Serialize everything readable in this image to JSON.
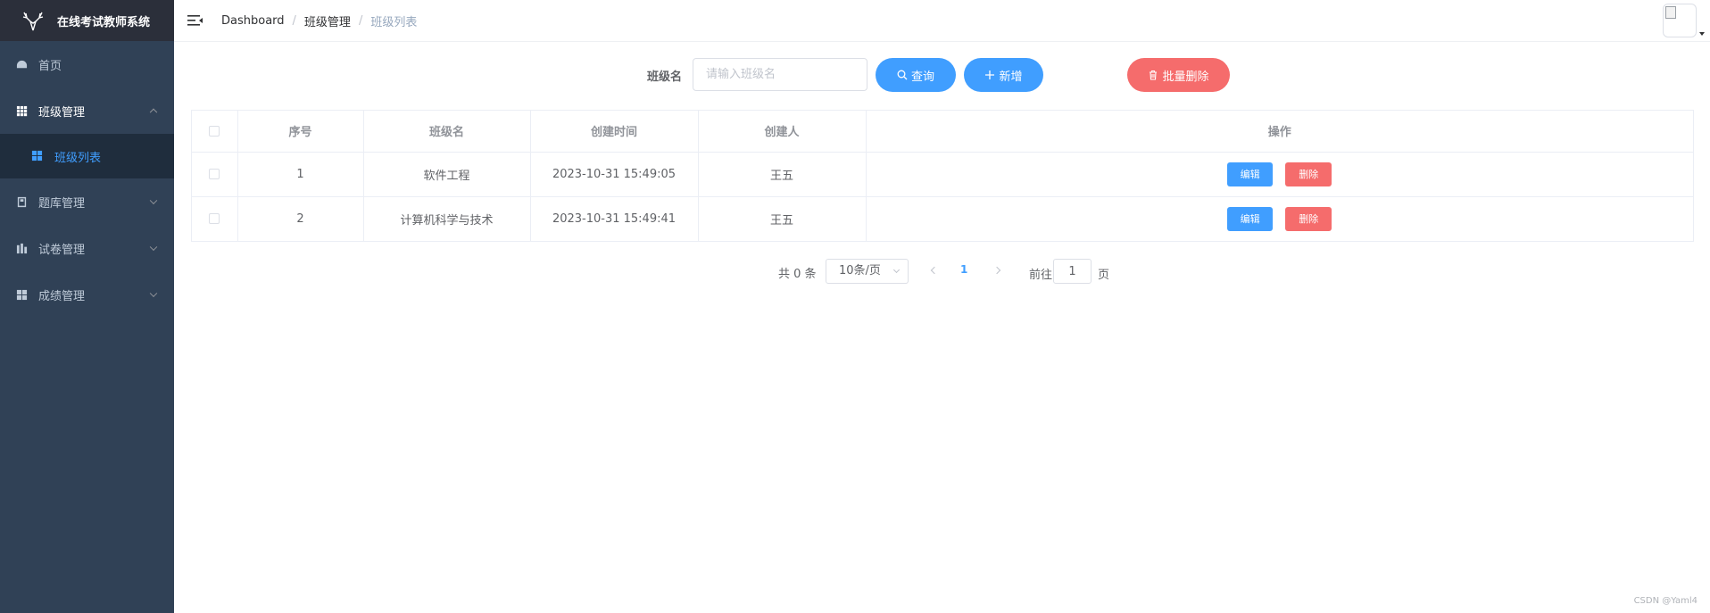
{
  "app": {
    "title": "在线考试教师系统"
  },
  "sidebar": {
    "items": [
      {
        "label": "首页",
        "icon": "dashboard-icon"
      },
      {
        "label": "班级管理",
        "icon": "grid-icon",
        "expanded": true,
        "children": [
          {
            "label": "班级列表",
            "icon": "apps-icon",
            "active": true
          }
        ]
      },
      {
        "label": "题库管理",
        "icon": "book-icon"
      },
      {
        "label": "试卷管理",
        "icon": "chart-icon"
      },
      {
        "label": "成绩管理",
        "icon": "apps-icon"
      }
    ]
  },
  "breadcrumb": [
    "Dashboard",
    "班级管理",
    "班级列表"
  ],
  "search": {
    "label": "班级名",
    "placeholder": "请输入班级名",
    "query_label": "查询",
    "add_label": "新增",
    "batch_delete_label": "批量删除"
  },
  "table": {
    "columns": [
      "序号",
      "班级名",
      "创建时间",
      "创建人",
      "操作"
    ],
    "rows": [
      {
        "index": "1",
        "name": "软件工程",
        "created_at": "2023-10-31 15:49:05",
        "creator": "王五"
      },
      {
        "index": "2",
        "name": "计算机科学与技术",
        "created_at": "2023-10-31 15:49:41",
        "creator": "王五"
      }
    ],
    "edit_label": "编辑",
    "delete_label": "删除"
  },
  "pagination": {
    "total_label": "共 0 条",
    "page_size": "10条/页",
    "current_page": "1",
    "goto_label": "前往",
    "goto_value": "1",
    "page_suffix": "页"
  },
  "watermark": "CSDN @Yaml4",
  "colors": {
    "sidebar_bg": "#304156",
    "primary": "#409eff",
    "danger": "#f56c6c"
  }
}
